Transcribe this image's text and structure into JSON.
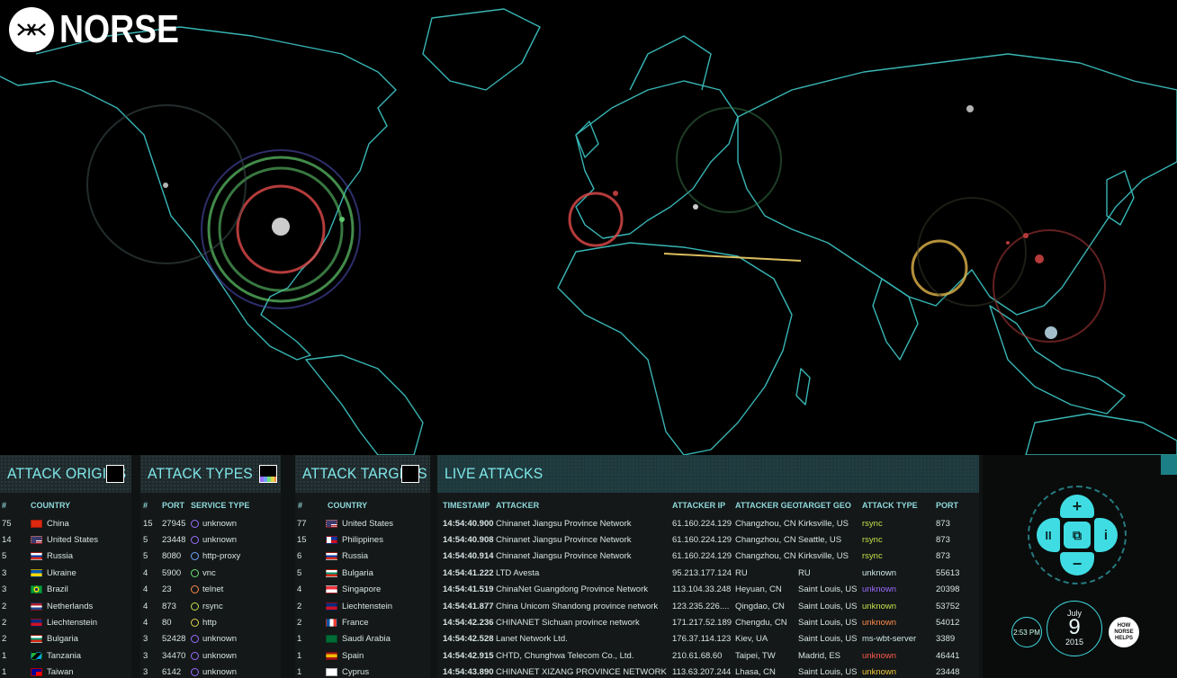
{
  "brand": {
    "name": "NORSE"
  },
  "colors": {
    "accent": "#3fdde3",
    "panel_title": "#7fe7ea",
    "map_lines": "#3fc9c9",
    "unknown_purple": "#9b6cff",
    "highlight_orange": "#f2a03a"
  },
  "origins": {
    "title": "ATTACK ORIGINS",
    "headers": [
      "#",
      "COUNTRY"
    ],
    "rows": [
      {
        "count": "75",
        "country": "China",
        "flag": "cn"
      },
      {
        "count": "14",
        "country": "United States",
        "flag": "us"
      },
      {
        "count": "5",
        "country": "Russia",
        "flag": "ru"
      },
      {
        "count": "3",
        "country": "Ukraine",
        "flag": "ua"
      },
      {
        "count": "3",
        "country": "Brazil",
        "flag": "br"
      },
      {
        "count": "2",
        "country": "Netherlands",
        "flag": "nl"
      },
      {
        "count": "2",
        "country": "Liechtenstein",
        "flag": "li"
      },
      {
        "count": "2",
        "country": "Bulgaria",
        "flag": "bg"
      },
      {
        "count": "1",
        "country": "Tanzania",
        "flag": "tz"
      },
      {
        "count": "1",
        "country": "Taiwan",
        "flag": "tw"
      }
    ]
  },
  "types": {
    "title": "ATTACK TYPES",
    "headers": [
      "#",
      "PORT",
      "SERVICE TYPE"
    ],
    "rows": [
      {
        "count": "15",
        "port": "27945",
        "service": "unknown",
        "color": "#9b6cff"
      },
      {
        "count": "5",
        "port": "23448",
        "service": "unknown",
        "color": "#9b6cff"
      },
      {
        "count": "5",
        "port": "8080",
        "service": "http-proxy",
        "color": "#6ea3ff"
      },
      {
        "count": "4",
        "port": "5900",
        "service": "vnc",
        "color": "#6de07a"
      },
      {
        "count": "4",
        "port": "23",
        "service": "telnet",
        "color": "#ff8a4a"
      },
      {
        "count": "4",
        "port": "873",
        "service": "rsync",
        "color": "#c6e04a"
      },
      {
        "count": "4",
        "port": "80",
        "service": "http",
        "color": "#e0d04a"
      },
      {
        "count": "3",
        "port": "52428",
        "service": "unknown",
        "color": "#9b6cff"
      },
      {
        "count": "3",
        "port": "34470",
        "service": "unknown",
        "color": "#9b6cff"
      },
      {
        "count": "3",
        "port": "6142",
        "service": "unknown",
        "color": "#9b6cff"
      }
    ]
  },
  "targets": {
    "title": "ATTACK TARGETS",
    "headers": [
      "#",
      "COUNTRY"
    ],
    "rows": [
      {
        "count": "77",
        "country": "United States",
        "flag": "us"
      },
      {
        "count": "15",
        "country": "Philippines",
        "flag": "ph"
      },
      {
        "count": "6",
        "country": "Russia",
        "flag": "ru"
      },
      {
        "count": "5",
        "country": "Bulgaria",
        "flag": "bg"
      },
      {
        "count": "4",
        "country": "Singapore",
        "flag": "sg"
      },
      {
        "count": "2",
        "country": "Liechtenstein",
        "flag": "li"
      },
      {
        "count": "2",
        "country": "France",
        "flag": "fr"
      },
      {
        "count": "1",
        "country": "Saudi Arabia",
        "flag": "sa"
      },
      {
        "count": "1",
        "country": "Spain",
        "flag": "es"
      },
      {
        "count": "1",
        "country": "Cyprus",
        "flag": "cy"
      }
    ]
  },
  "live": {
    "title": "LIVE ATTACKS",
    "headers": [
      "TIMESTAMP",
      "ATTACKER",
      "ATTACKER IP",
      "ATTACKER GEO",
      "TARGET GEO",
      "ATTACK TYPE",
      "PORT"
    ],
    "rows": [
      {
        "ts": "14:54:40.900",
        "attacker": "Chinanet Jiangsu Province Network",
        "ip": "61.160.224.129",
        "ageo": "Changzhou, CN",
        "tgeo": "Kirksville, US",
        "type": "rsync",
        "type_color": "#c6e04a",
        "port": "873"
      },
      {
        "ts": "14:54:40.908",
        "attacker": "Chinanet Jiangsu Province Network",
        "ip": "61.160.224.129",
        "ageo": "Changzhou, CN",
        "tgeo": "Seattle, US",
        "type": "rsync",
        "type_color": "#c6e04a",
        "port": "873"
      },
      {
        "ts": "14:54:40.914",
        "attacker": "Chinanet Jiangsu Province Network",
        "ip": "61.160.224.129",
        "ageo": "Changzhou, CN",
        "tgeo": "Kirksville, US",
        "type": "rsync",
        "type_color": "#c6e04a",
        "port": "873"
      },
      {
        "ts": "14:54:41.222",
        "attacker": "LTD Avesta",
        "ip": "95.213.177.124",
        "ageo": "RU",
        "tgeo": "RU",
        "type": "unknown",
        "type_color": "#cfe6e6",
        "port": "55613"
      },
      {
        "ts": "14:54:41.519",
        "attacker": "ChinaNet Guangdong Province Network",
        "ip": "113.104.33.248",
        "ageo": "Heyuan, CN",
        "tgeo": "Saint Louis, US",
        "type": "unknown",
        "type_color": "#9b6cff",
        "port": "20398"
      },
      {
        "ts": "14:54:41.877",
        "attacker": "China Unicom Shandong province network",
        "ip": "123.235.226....",
        "ageo": "Qingdao, CN",
        "tgeo": "Saint Louis, US",
        "type": "unknown",
        "type_color": "#c6e04a",
        "port": "53752"
      },
      {
        "ts": "14:54:42.236",
        "attacker": "CHINANET Sichuan province network",
        "ip": "171.217.52.189",
        "ageo": "Chengdu, CN",
        "tgeo": "Saint Louis, US",
        "type": "unknown",
        "type_color": "#ff8a4a",
        "port": "54012"
      },
      {
        "ts": "14:54:42.528",
        "attacker": "Lanet Network Ltd.",
        "ip": "176.37.114.123",
        "ageo": "Kiev, UA",
        "tgeo": "Saint Louis, US",
        "type": "ms-wbt-server",
        "type_color": "#cfe6e6",
        "port": "3389"
      },
      {
        "ts": "14:54:42.915",
        "attacker": "CHTD, Chunghwa Telecom Co., Ltd.",
        "ip": "210.61.68.60",
        "ageo": "Taipei, TW",
        "tgeo": "Madrid, ES",
        "type": "unknown",
        "type_color": "#ff5a4a",
        "port": "46441"
      },
      {
        "ts": "14:54:43.890",
        "attacker": "CHINANET XIZANG PROVINCE NETWORK",
        "ip": "113.63.207.244",
        "ageo": "Lhasa, CN",
        "tgeo": "Saint Louis, US",
        "type": "unknown",
        "type_color": "#f2c83a",
        "port": "23448"
      }
    ]
  },
  "controls": {
    "zoom_in": "+",
    "zoom_out": "−",
    "pause": "II",
    "info": "i",
    "fullscreen": "⧉",
    "time": "2:53 PM",
    "month": "July",
    "day": "9",
    "year": "2015",
    "help": "HOW NORSE HELPS"
  }
}
